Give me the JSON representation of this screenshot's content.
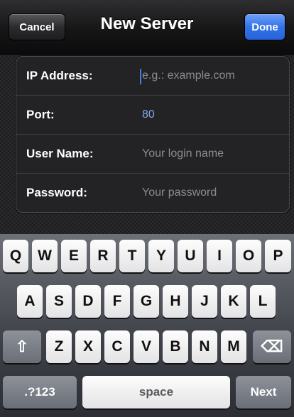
{
  "navbar": {
    "title": "New Server",
    "cancel_label": "Cancel",
    "done_label": "Done"
  },
  "form": {
    "fields": [
      {
        "label": "IP Address:",
        "placeholder": "e.g.: example.com",
        "value": ""
      },
      {
        "label": "Port:",
        "placeholder": "",
        "value": "80"
      },
      {
        "label": "User Name:",
        "placeholder": "Your login name",
        "value": ""
      },
      {
        "label": "Password:",
        "placeholder": "Your password",
        "value": ""
      }
    ]
  },
  "keyboard": {
    "row1": [
      "Q",
      "W",
      "E",
      "R",
      "T",
      "Y",
      "U",
      "I",
      "O",
      "P"
    ],
    "row2": [
      "A",
      "S",
      "D",
      "F",
      "G",
      "H",
      "J",
      "K",
      "L"
    ],
    "row3": [
      "Z",
      "X",
      "C",
      "V",
      "B",
      "N",
      "M"
    ],
    "shift_symbol": "⇧",
    "delete_symbol": "⌫",
    "numbers_label": ".?123",
    "space_label": "space",
    "next_label": "Next"
  }
}
